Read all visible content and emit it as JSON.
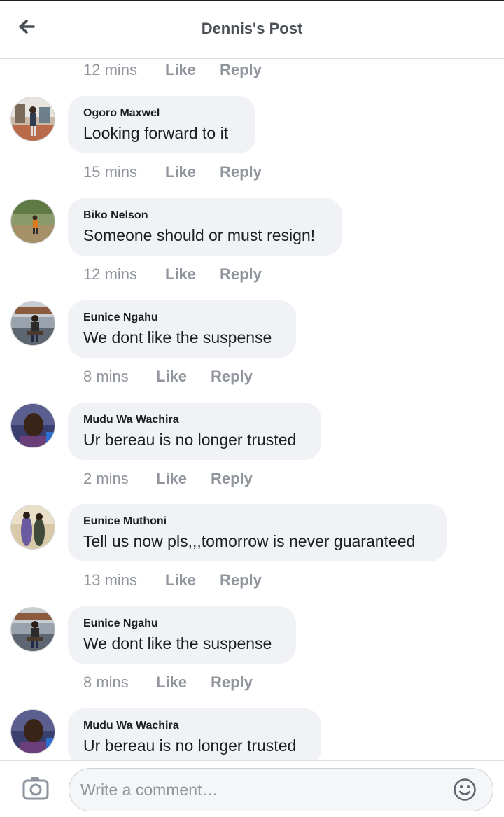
{
  "header": {
    "title": "Dennis's Post",
    "back_icon": "arrow-left-icon"
  },
  "top_meta": {
    "time": "12 mins",
    "like": "Like",
    "reply": "Reply"
  },
  "comments": [
    {
      "author": "Ogoro Maxwel",
      "text": "Looking forward to it",
      "time": "15 mins",
      "like": "Like",
      "reply": "Reply"
    },
    {
      "author": "Biko Nelson",
      "text": "Someone should or must resign!",
      "time": "12 mins",
      "like": "Like",
      "reply": "Reply"
    },
    {
      "author": "Eunice Ngahu",
      "text": "We dont like the suspense",
      "time": "8 mins",
      "like": "Like",
      "reply": "Reply"
    },
    {
      "author": "Mudu Wa Wachira",
      "text": "Ur bereau is no longer trusted",
      "time": "2 mins",
      "like": "Like",
      "reply": "Reply"
    },
    {
      "author": "Eunice Muthoni",
      "text": "Tell us now pls,,,tomorrow is never guaranteed",
      "time": "13 mins",
      "like": "Like",
      "reply": "Reply"
    },
    {
      "author": "Eunice Ngahu",
      "text": "We dont like the suspense",
      "time": "8 mins",
      "like": "Like",
      "reply": "Reply"
    },
    {
      "author": "Mudu Wa Wachira",
      "text": "Ur bereau is no longer trusted"
    }
  ],
  "footer": {
    "placeholder": "Write a comment…",
    "camera_icon": "camera-icon",
    "emoji_icon": "smiley-icon"
  }
}
